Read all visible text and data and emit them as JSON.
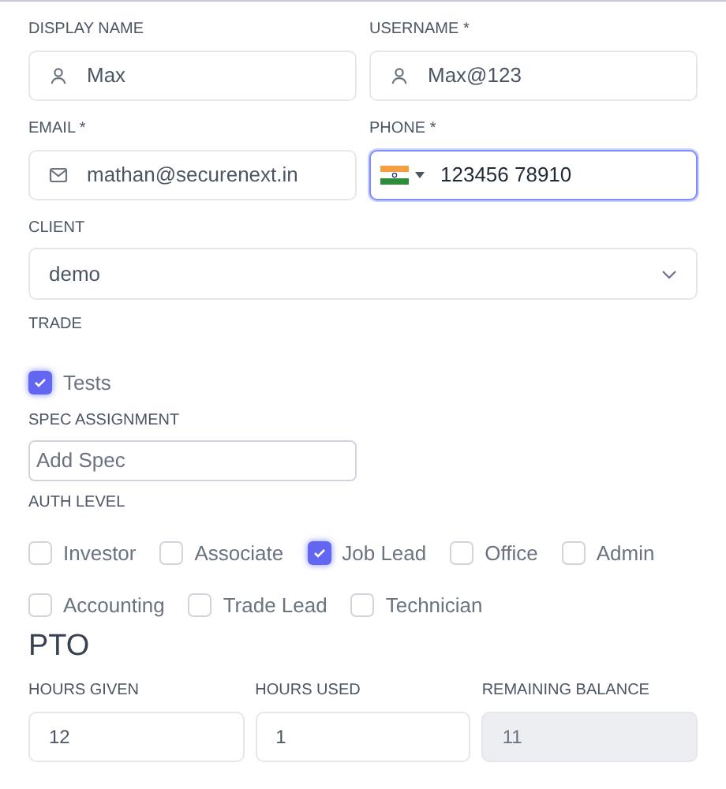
{
  "fields": [
    {
      "label": "DISPLAY NAME",
      "kind": "user",
      "value": "Max",
      "focused": false
    },
    {
      "label": "USERNAME *",
      "kind": "user",
      "value": "Max@123",
      "focused": false
    },
    {
      "label": "EMAIL *",
      "kind": "email",
      "value": "mathan@securenext.in",
      "focused": false
    },
    {
      "label": "PHONE *",
      "kind": "phone",
      "value": "123456 78910",
      "focused": true
    }
  ],
  "client": {
    "label": "CLIENT",
    "value": "demo"
  },
  "trade": {
    "label": "TRADE",
    "options": [
      {
        "label": "Tests",
        "checked": true
      }
    ]
  },
  "spec_assignment": {
    "label": "SPEC ASSIGNMENT",
    "placeholder": "Add Spec"
  },
  "auth_level": {
    "label": "AUTH LEVEL",
    "options": [
      {
        "label": "Investor",
        "checked": false
      },
      {
        "label": "Associate",
        "checked": false
      },
      {
        "label": "Job Lead",
        "checked": true
      },
      {
        "label": "Office",
        "checked": false
      },
      {
        "label": "Admin",
        "checked": false
      },
      {
        "label": "Accounting",
        "checked": false
      },
      {
        "label": "Trade Lead",
        "checked": false
      },
      {
        "label": "Technician",
        "checked": false
      }
    ]
  },
  "pto": {
    "title": "PTO",
    "fields": [
      {
        "label": "HOURS GIVEN",
        "value": "12",
        "disabled": false
      },
      {
        "label": "HOURS USED",
        "value": "1",
        "disabled": false
      },
      {
        "label": "REMAINING BALANCE",
        "value": "11",
        "disabled": true
      }
    ]
  }
}
